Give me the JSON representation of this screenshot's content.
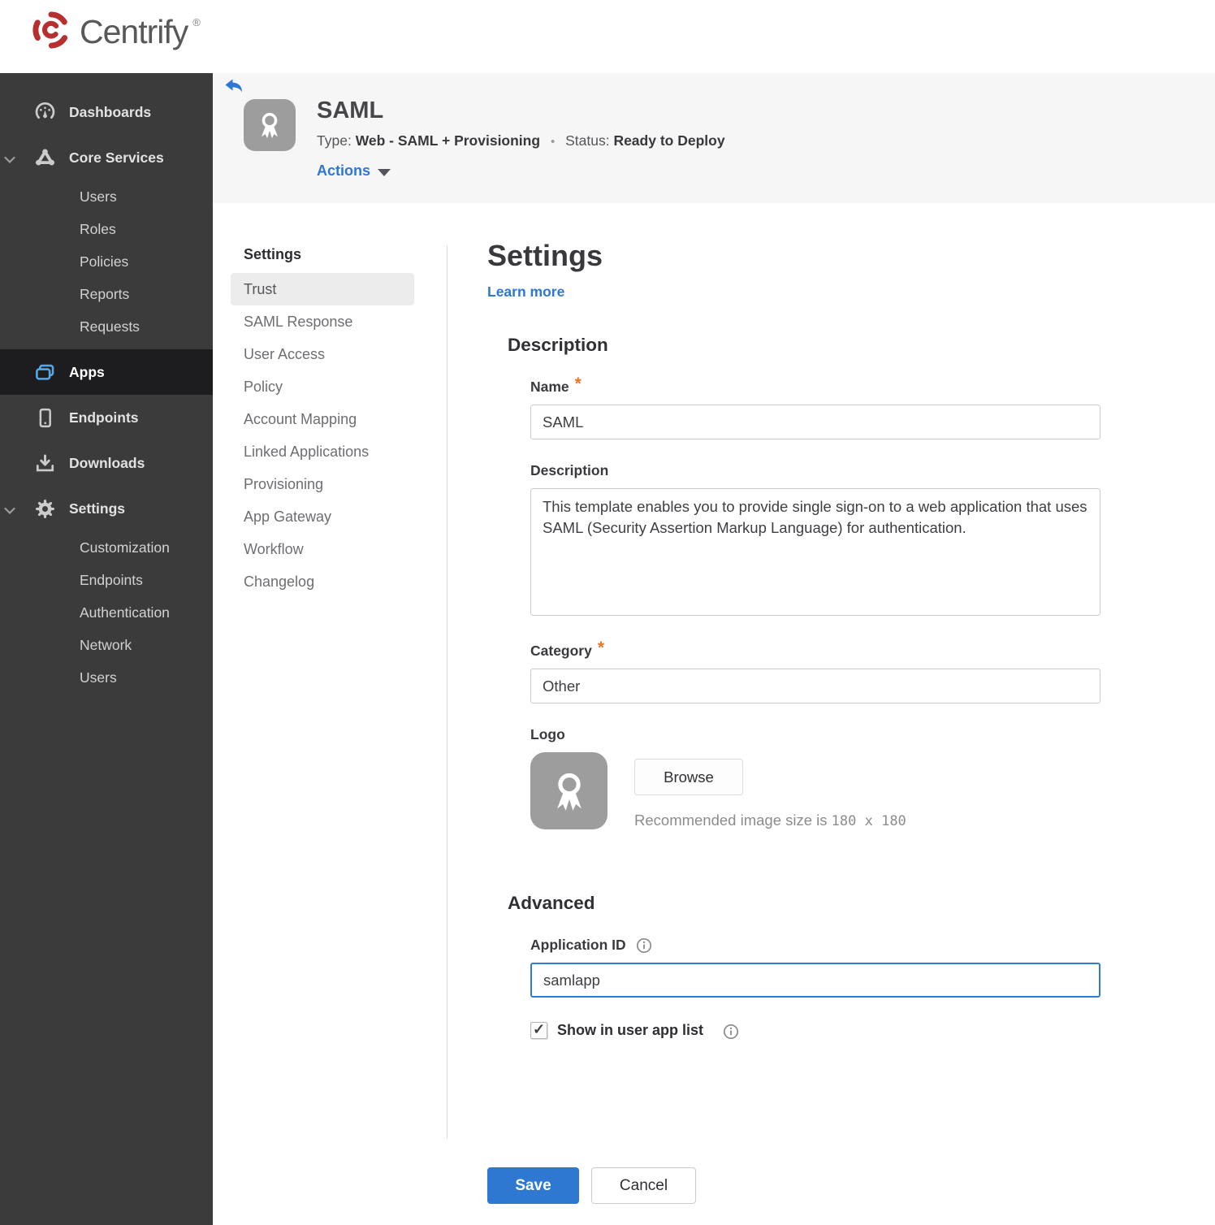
{
  "brand": {
    "name": "Centrify",
    "registered": "®"
  },
  "colors": {
    "accent_blue": "#2e78d2",
    "link_blue": "#2e77d4",
    "status_red": "#9e2022",
    "required_orange": "#e97627",
    "sidebar_bg": "#3b3b3b",
    "sidebar_active_bg": "#1d1d20",
    "header_bg": "#f6f6f7",
    "apps_icon_blue": "#54a8e8"
  },
  "sidebar": {
    "items": [
      {
        "label": "Dashboards",
        "icon": "dashboards-icon"
      },
      {
        "label": "Core Services",
        "icon": "core-services-icon",
        "expanded": true,
        "children": [
          {
            "label": "Users"
          },
          {
            "label": "Roles"
          },
          {
            "label": "Policies"
          },
          {
            "label": "Reports"
          },
          {
            "label": "Requests"
          }
        ]
      },
      {
        "label": "Apps",
        "icon": "apps-icon",
        "active": true
      },
      {
        "label": "Endpoints",
        "icon": "endpoints-icon"
      },
      {
        "label": "Downloads",
        "icon": "downloads-icon"
      },
      {
        "label": "Settings",
        "icon": "settings-icon",
        "expanded": true,
        "children": [
          {
            "label": "Customization"
          },
          {
            "label": "Endpoints"
          },
          {
            "label": "Authentication"
          },
          {
            "label": "Network"
          },
          {
            "label": "Users"
          }
        ]
      }
    ]
  },
  "app_header": {
    "title": "SAML",
    "type_label": "Type:",
    "type_value": "Web - SAML + Provisioning",
    "separator": "•",
    "status_label": "Status:",
    "status_value": "Ready to Deploy",
    "actions_label": "Actions"
  },
  "subnav": {
    "header": "Settings",
    "items": [
      {
        "label": "Trust",
        "active": true
      },
      {
        "label": "SAML Response"
      },
      {
        "label": "User Access"
      },
      {
        "label": "Policy"
      },
      {
        "label": "Account Mapping"
      },
      {
        "label": "Linked Applications"
      },
      {
        "label": "Provisioning"
      },
      {
        "label": "App Gateway"
      },
      {
        "label": "Workflow"
      },
      {
        "label": "Changelog"
      }
    ]
  },
  "form": {
    "title": "Settings",
    "learn_more": "Learn more",
    "required_marker": "*",
    "description_section": {
      "heading": "Description"
    },
    "name_field": {
      "label": "Name",
      "value": "SAML"
    },
    "description_field": {
      "label": "Description",
      "value": "This template enables you to provide single sign-on to a web application that uses SAML (Security Assertion Markup Language) for authentication."
    },
    "category_field": {
      "label": "Category",
      "value": "Other"
    },
    "logo_field": {
      "label": "Logo",
      "browse_label": "Browse",
      "hint_text": "Recommended image size is",
      "hint_size": "180 x 180"
    },
    "advanced_section": {
      "heading": "Advanced"
    },
    "application_id_field": {
      "label": "Application ID",
      "value": "samlapp"
    },
    "show_in_user_app_list": {
      "label": "Show in user app list",
      "checked_attr": "checked"
    }
  },
  "footer": {
    "save_label": "Save",
    "cancel_label": "Cancel"
  }
}
